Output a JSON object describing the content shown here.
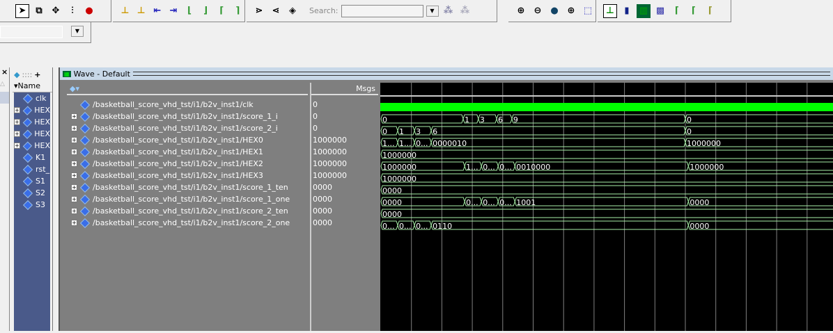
{
  "toolbar": {
    "search_label": "Search:",
    "search_value": ""
  },
  "object_panel": {
    "name_header": "Name",
    "items": [
      {
        "label": "clk",
        "expand": false
      },
      {
        "label": "HEX",
        "expand": true
      },
      {
        "label": "HEX",
        "expand": true
      },
      {
        "label": "HEX",
        "expand": true
      },
      {
        "label": "HEX",
        "expand": true
      },
      {
        "label": "K1",
        "expand": false
      },
      {
        "label": "rst_",
        "expand": false
      },
      {
        "label": "S1",
        "expand": false
      },
      {
        "label": "S2",
        "expand": false
      },
      {
        "label": "S3",
        "expand": false
      }
    ]
  },
  "wave": {
    "title": "Wave - Default",
    "msgs_header": "Msgs",
    "colors": {
      "clock": "#00ff00",
      "bus": "#a8f0a8",
      "grid": "#808080"
    },
    "signals": [
      {
        "path": "/basketball_score_vhd_tst/i1/b2v_inst1/clk",
        "value": "0",
        "expand": false,
        "kind": "clock",
        "segments": []
      },
      {
        "path": "/basketball_score_vhd_tst/i1/b2v_inst1/score_1_i",
        "value": "0",
        "expand": true,
        "kind": "bus",
        "segments": [
          {
            "t": 0,
            "v": "0"
          },
          {
            "t": 27,
            "v": "1"
          },
          {
            "t": 32,
            "v": "3"
          },
          {
            "t": 38,
            "v": "6"
          },
          {
            "t": 43,
            "v": "9"
          },
          {
            "t": 100,
            "v": "0"
          }
        ]
      },
      {
        "path": "/basketball_score_vhd_tst/i1/b2v_inst1/score_2_i",
        "value": "0",
        "expand": true,
        "kind": "bus",
        "segments": [
          {
            "t": 0,
            "v": "0"
          },
          {
            "t": 5.5,
            "v": "1"
          },
          {
            "t": 11,
            "v": "3"
          },
          {
            "t": 16.5,
            "v": "6"
          },
          {
            "t": 100,
            "v": "0"
          }
        ]
      },
      {
        "path": "/basketball_score_vhd_tst/i1/b2v_inst1/HEX0",
        "value": "1000000",
        "expand": true,
        "kind": "bus",
        "segments": [
          {
            "t": 0,
            "v": "1..."
          },
          {
            "t": 5.5,
            "v": "1..."
          },
          {
            "t": 11,
            "v": "0..."
          },
          {
            "t": 16.5,
            "v": "0000010"
          },
          {
            "t": 100,
            "v": "1000000"
          }
        ]
      },
      {
        "path": "/basketball_score_vhd_tst/i1/b2v_inst1/HEX1",
        "value": "1000000",
        "expand": true,
        "kind": "bus",
        "segments": [
          {
            "t": 0,
            "v": "1000000"
          }
        ]
      },
      {
        "path": "/basketball_score_vhd_tst/i1/b2v_inst1/HEX2",
        "value": "1000000",
        "expand": true,
        "kind": "bus",
        "segments": [
          {
            "t": 0,
            "v": "1000000"
          },
          {
            "t": 27.5,
            "v": "1..."
          },
          {
            "t": 33,
            "v": "0..."
          },
          {
            "t": 38.5,
            "v": "0..."
          },
          {
            "t": 44,
            "v": "0010000"
          },
          {
            "t": 101,
            "v": "1000000"
          }
        ]
      },
      {
        "path": "/basketball_score_vhd_tst/i1/b2v_inst1/HEX3",
        "value": "1000000",
        "expand": true,
        "kind": "bus",
        "segments": [
          {
            "t": 0,
            "v": "1000000"
          }
        ]
      },
      {
        "path": "/basketball_score_vhd_tst/i1/b2v_inst1/score_1_ten",
        "value": "0000",
        "expand": true,
        "kind": "bus",
        "segments": [
          {
            "t": 0,
            "v": "0000"
          }
        ]
      },
      {
        "path": "/basketball_score_vhd_tst/i1/b2v_inst1/score_1_one",
        "value": "0000",
        "expand": true,
        "kind": "bus",
        "segments": [
          {
            "t": 0,
            "v": "0000"
          },
          {
            "t": 27.5,
            "v": "0..."
          },
          {
            "t": 33,
            "v": "0..."
          },
          {
            "t": 38.5,
            "v": "0..."
          },
          {
            "t": 44,
            "v": "1001"
          },
          {
            "t": 101,
            "v": "0000"
          }
        ]
      },
      {
        "path": "/basketball_score_vhd_tst/i1/b2v_inst1/score_2_ten",
        "value": "0000",
        "expand": true,
        "kind": "bus",
        "segments": [
          {
            "t": 0,
            "v": "0000"
          }
        ]
      },
      {
        "path": "/basketball_score_vhd_tst/i1/b2v_inst1/score_2_one",
        "value": "0000",
        "expand": true,
        "kind": "bus",
        "segments": [
          {
            "t": 0,
            "v": "0..."
          },
          {
            "t": 5.5,
            "v": "0..."
          },
          {
            "t": 11,
            "v": "0..."
          },
          {
            "t": 16.5,
            "v": "0110"
          },
          {
            "t": 101,
            "v": "0000"
          }
        ]
      }
    ]
  }
}
